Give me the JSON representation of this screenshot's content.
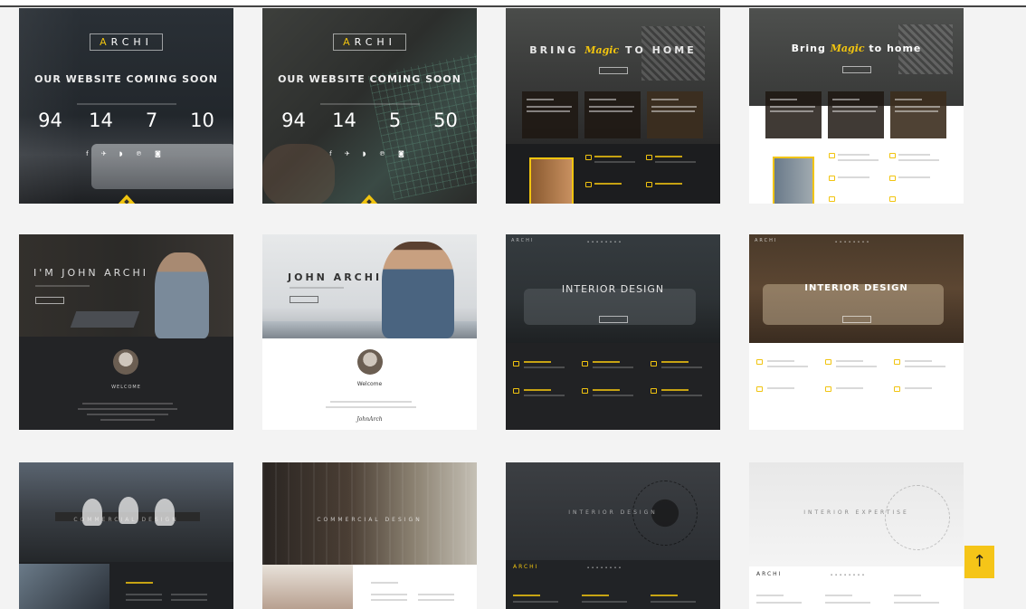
{
  "colors": {
    "accent": "#f1c40f",
    "scroll_button": "#f5c518",
    "page_bg": "#f3f3f3"
  },
  "cards": {
    "c1": {
      "logo_prefix": "A",
      "logo_rest": "RCHI",
      "title": "OUR WEBSITE COMING SOON",
      "countdown": [
        {
          "value": "94"
        },
        {
          "value": "14"
        },
        {
          "value": "7"
        },
        {
          "value": "10"
        }
      ],
      "socials": "f ✈ ◗ ℗ ◙"
    },
    "c2": {
      "logo_prefix": "A",
      "logo_rest": "RCHI",
      "title": "OUR WEBSITE COMING SOON",
      "countdown": [
        {
          "value": "94"
        },
        {
          "value": "14"
        },
        {
          "value": "5"
        },
        {
          "value": "50"
        }
      ],
      "socials": "f ✈ ◗ ℗ ◙"
    },
    "c3": {
      "title_a": "BRING ",
      "title_script": "Magic",
      "title_b": " TO HOME"
    },
    "c4": {
      "title_a": "Bring ",
      "title_script": "Magic",
      "title_b": " to home"
    },
    "c5": {
      "title": "I'M JOHN ARCHI",
      "welcome": "WELCOME"
    },
    "c6": {
      "title": "JOHN ARCHI",
      "welcome": "Welcome",
      "signature": "JohnArch"
    },
    "c7": {
      "logo": "ARCHI",
      "title": "INTERIOR DESIGN"
    },
    "c8": {
      "logo": "ARCHI",
      "title": "INTERIOR DESIGN"
    },
    "c9": {
      "title": "COMMERCIAL DESIGN"
    },
    "c10": {
      "title": "COMMERCIAL DESIGN"
    },
    "c11": {
      "title": "INTERIOR DESIGN",
      "logo": "ARCHI"
    },
    "c12": {
      "title": "INTERIOR EXPERTISE",
      "logo": "ARCHI"
    }
  },
  "scroll_top": {
    "label": "↑"
  }
}
